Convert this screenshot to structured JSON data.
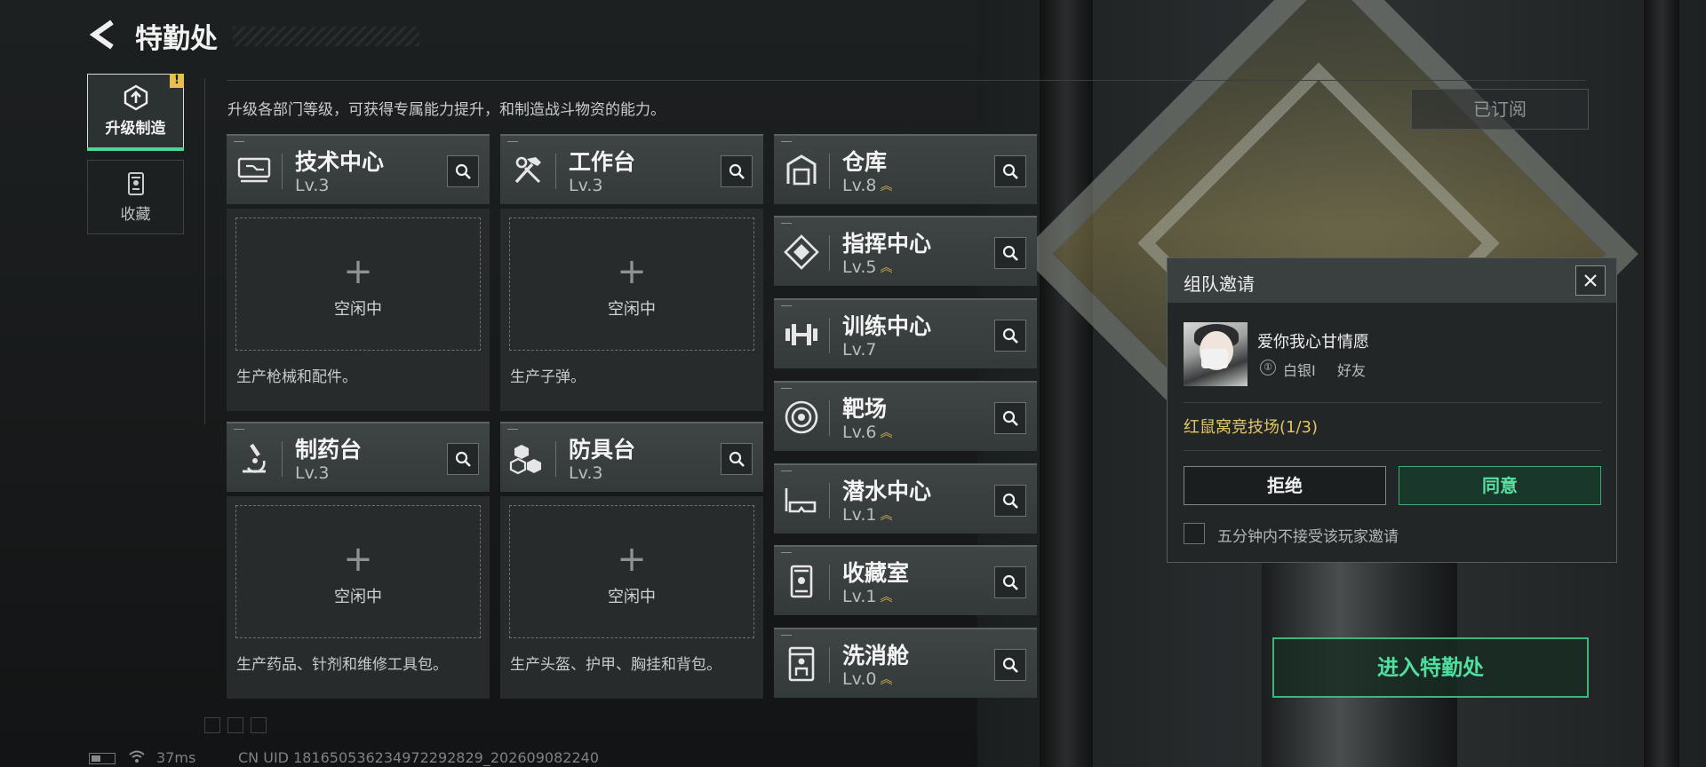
{
  "header": {
    "title": "特勤处",
    "description": "升级各部门等级，可获得专属能力提升，和制造战斗物资的能力。"
  },
  "nav": {
    "tabs": [
      {
        "label": "升级制造",
        "active": true,
        "alert": "!"
      },
      {
        "label": "收藏",
        "active": false
      }
    ]
  },
  "workshops": [
    {
      "name": "技术中心",
      "level": "Lv.3",
      "slot_status": "空闲中",
      "slot_plus": "+",
      "description": "生产枪械和配件。"
    },
    {
      "name": "工作台",
      "level": "Lv.3",
      "slot_status": "空闲中",
      "slot_plus": "+",
      "description": "生产子弹。"
    },
    {
      "name": "制药台",
      "level": "Lv.3",
      "slot_status": "空闲中",
      "slot_plus": "+",
      "description": "生产药品、针剂和维修工具包。"
    },
    {
      "name": "防具台",
      "level": "Lv.3",
      "slot_status": "空闲中",
      "slot_plus": "+",
      "description": "生产头盔、护甲、胸挂和背包。"
    }
  ],
  "facilities": [
    {
      "name": "仓库",
      "level": "Lv.8",
      "upgradable": true
    },
    {
      "name": "指挥中心",
      "level": "Lv.5",
      "upgradable": true
    },
    {
      "name": "训练中心",
      "level": "Lv.7",
      "upgradable": false
    },
    {
      "name": "靶场",
      "level": "Lv.6",
      "upgradable": true
    },
    {
      "name": "潜水中心",
      "level": "Lv.1",
      "upgradable": true
    },
    {
      "name": "收藏室",
      "level": "Lv.1",
      "upgradable": true
    },
    {
      "name": "洗消舱",
      "level": "Lv.0",
      "upgradable": true
    }
  ],
  "subscribed_label": "已订阅",
  "invite": {
    "title": "组队邀请",
    "player_name": "爱你我心甘情愿",
    "rank_badge": "①",
    "rank": "白银I",
    "relation": "好友",
    "mode": "红鼠窝竞技场(1/3)",
    "reject_label": "拒绝",
    "accept_label": "同意",
    "mute_label": "五分钟内不接受该玩家邀请"
  },
  "enter_button": "进入特勤处",
  "status_bar": {
    "ping": "37ms",
    "uid": "CN UID 181650536234972292829_202609082240"
  },
  "colors": {
    "accent_green": "#4fe0a0",
    "level_arrow": "#d9b04a",
    "mode_text": "#e2c567"
  }
}
